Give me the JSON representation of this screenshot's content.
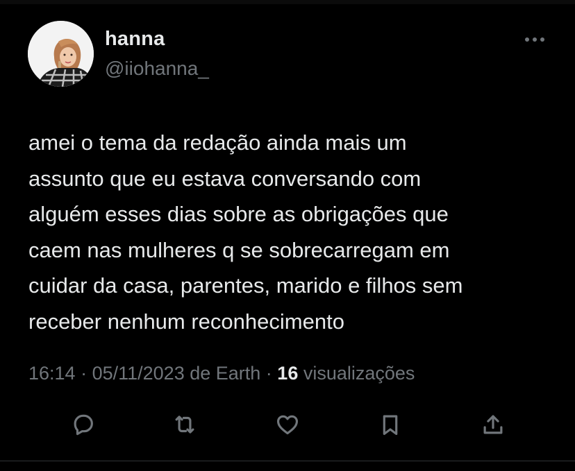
{
  "tweet": {
    "author": {
      "display_name": "hanna",
      "handle": "@iiohanna_"
    },
    "text": "amei o tema da redação ainda mais um\nassunto que eu estava conversando com\nalguém esses dias sobre as  obrigações que\ncaem nas mulheres q se  sobrecarregam em\ncuidar da casa, parentes, marido e filhos sem\nreceber nenhum reconhecimento",
    "time": "16:14",
    "sep1": " · ",
    "date": "05/11/2023",
    "source": " de Earth",
    "sep2": " · ",
    "views_count": "16",
    "views_label": " visualizações"
  },
  "icons": {
    "more": "more-horizontal-icon",
    "reply": "reply-icon",
    "retweet": "retweet-icon",
    "like": "heart-icon",
    "bookmark": "bookmark-icon",
    "share": "share-icon"
  },
  "colors": {
    "background": "#000000",
    "primary_text": "#e7e9ea",
    "secondary_text": "#71767b"
  }
}
